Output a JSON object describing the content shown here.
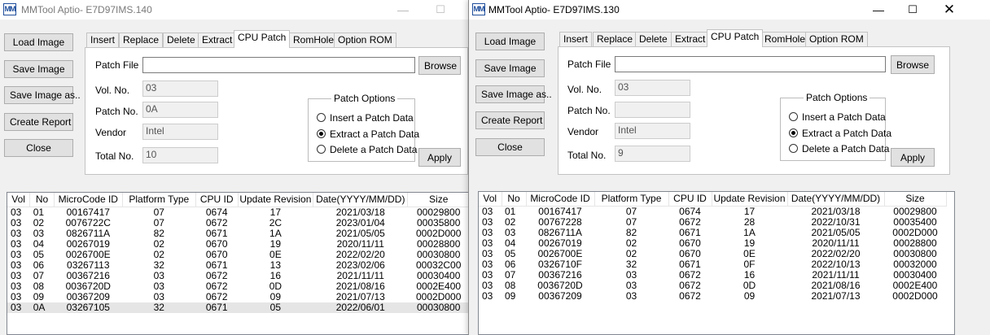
{
  "common": {
    "app_icon": "MM",
    "buttons": {
      "load": "Load Image",
      "save": "Save Image",
      "save_as": "Save Image as..",
      "report": "Create Report",
      "close": "Close",
      "browse": "Browse",
      "apply": "Apply"
    },
    "tabs": [
      "Insert",
      "Replace",
      "Delete",
      "Extract",
      "CPU Patch",
      "RomHole",
      "Option ROM"
    ],
    "labels": {
      "patch_file": "Patch File",
      "vol_no": "Vol. No.",
      "patch_no": "Patch No.",
      "vendor": "Vendor",
      "total_no": "Total No."
    },
    "patch_options": {
      "title": "Patch Options",
      "insert": "Insert a Patch Data",
      "extract": "Extract a Patch Data",
      "delete": "Delete a Patch Data"
    },
    "columns": [
      "Vol",
      "No",
      "MicroCode ID",
      "Platform Type",
      "CPU ID",
      "Update Revision",
      "Date(YYYY/MM/DD)",
      "Size"
    ],
    "window_controls": {
      "minimize": "—",
      "maximize": "☐",
      "close": "✕"
    }
  },
  "left": {
    "title": "MMTool Aptio- E7D97IMS.140",
    "fields": {
      "patch_file": "",
      "vol_no": "03",
      "patch_no": "0A",
      "vendor": "Intel",
      "total_no": "10"
    },
    "rows": [
      [
        "03",
        "01",
        "00167417",
        "07",
        "0674",
        "17",
        "2021/03/18",
        "00029800"
      ],
      [
        "03",
        "02",
        "0076722C",
        "07",
        "0672",
        "2C",
        "2023/01/04",
        "00035800"
      ],
      [
        "03",
        "03",
        "0826711A",
        "82",
        "0671",
        "1A",
        "2021/05/05",
        "0002D000"
      ],
      [
        "03",
        "04",
        "00267019",
        "02",
        "0670",
        "19",
        "2020/11/11",
        "00028800"
      ],
      [
        "03",
        "05",
        "0026700E",
        "02",
        "0670",
        "0E",
        "2022/02/20",
        "00030800"
      ],
      [
        "03",
        "06",
        "03267113",
        "32",
        "0671",
        "13",
        "2023/02/06",
        "00032C00"
      ],
      [
        "03",
        "07",
        "00367216",
        "03",
        "0672",
        "16",
        "2021/11/11",
        "00030400"
      ],
      [
        "03",
        "08",
        "0036720D",
        "03",
        "0672",
        "0D",
        "2021/08/16",
        "0002E400"
      ],
      [
        "03",
        "09",
        "00367209",
        "03",
        "0672",
        "09",
        "2021/07/13",
        "0002D000"
      ],
      [
        "03",
        "0A",
        "03267105",
        "32",
        "0671",
        "05",
        "2022/06/01",
        "00030800"
      ]
    ]
  },
  "right": {
    "title": "MMTool Aptio- E7D97IMS.130",
    "fields": {
      "patch_file": "",
      "vol_no": "03",
      "patch_no": "",
      "vendor": "Intel",
      "total_no": "9"
    },
    "rows": [
      [
        "03",
        "01",
        "00167417",
        "07",
        "0674",
        "17",
        "2021/03/18",
        "00029800"
      ],
      [
        "03",
        "02",
        "00767228",
        "07",
        "0672",
        "28",
        "2022/10/31",
        "00035400"
      ],
      [
        "03",
        "03",
        "0826711A",
        "82",
        "0671",
        "1A",
        "2021/05/05",
        "0002D000"
      ],
      [
        "03",
        "04",
        "00267019",
        "02",
        "0670",
        "19",
        "2020/11/11",
        "00028800"
      ],
      [
        "03",
        "05",
        "0026700E",
        "02",
        "0670",
        "0E",
        "2022/02/20",
        "00030800"
      ],
      [
        "03",
        "06",
        "0326710F",
        "32",
        "0671",
        "0F",
        "2022/10/13",
        "00032000"
      ],
      [
        "03",
        "07",
        "00367216",
        "03",
        "0672",
        "16",
        "2021/11/11",
        "00030400"
      ],
      [
        "03",
        "08",
        "0036720D",
        "03",
        "0672",
        "0D",
        "2021/08/16",
        "0002E400"
      ],
      [
        "03",
        "09",
        "00367209",
        "03",
        "0672",
        "09",
        "2021/07/13",
        "0002D000"
      ]
    ]
  }
}
